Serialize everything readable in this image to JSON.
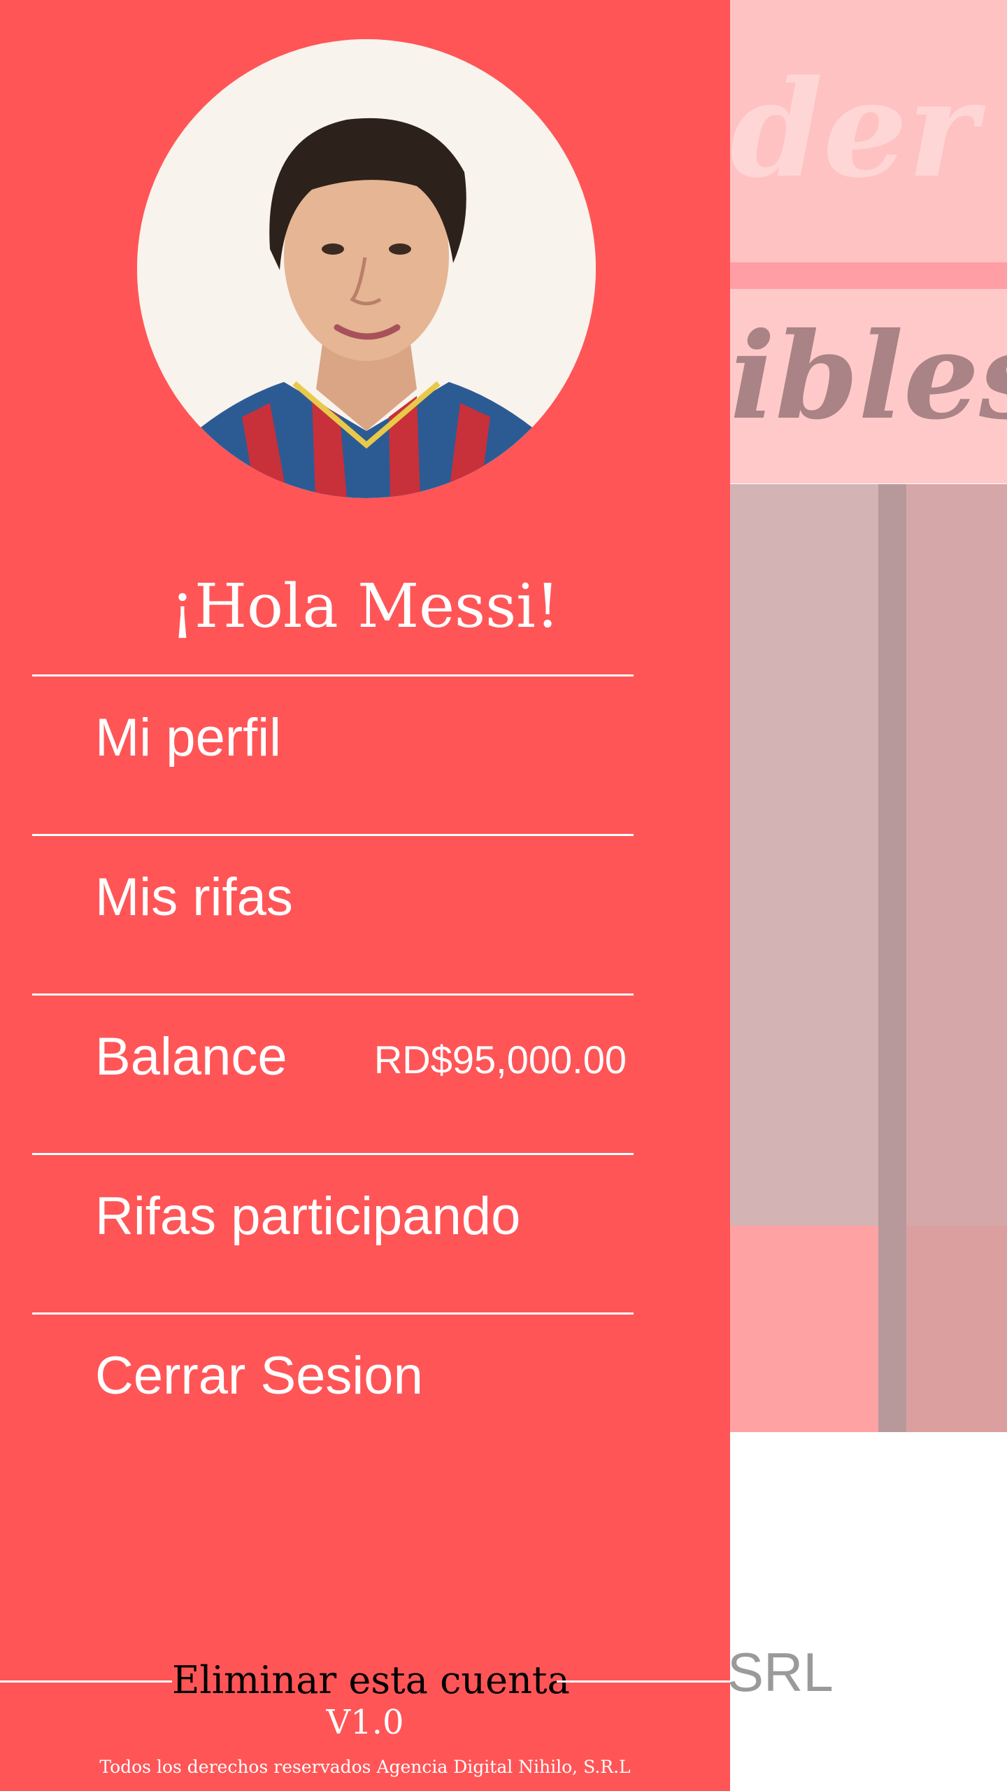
{
  "background": {
    "header_text": "der",
    "subheader_text": "ibles",
    "footer_text": "SRL"
  },
  "drawer": {
    "avatar": "profile-photo",
    "greeting": "¡Hola Messi!",
    "menu": [
      {
        "label": "Mi perfil"
      },
      {
        "label": "Mis rifas"
      },
      {
        "label": "Balance",
        "value": "RD$95,000.00"
      },
      {
        "label": "Rifas participando"
      },
      {
        "label": "Cerrar Sesion"
      }
    ],
    "delete_account": "Eliminar esta cuenta",
    "version": "V1.0",
    "copyright": "Todos los derechos reservados Agencia Digital Nihilo, S.R.L"
  },
  "colors": {
    "drawer_bg": "#ff5557",
    "text": "#ffffff",
    "delete_text": "#000000"
  }
}
